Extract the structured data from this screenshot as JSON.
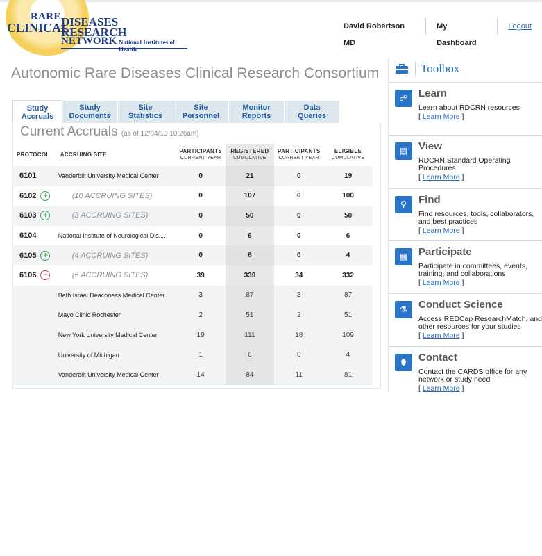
{
  "logo": {
    "line_rare": "RARE",
    "line_clinical": "CLINICAL",
    "line_diseases": "DISEASES",
    "line_research": "RESEARCH",
    "line_network": "NETWORK",
    "line_nih": "National Institutes of Health"
  },
  "topnav": {
    "user": "David Robertson MD",
    "dashboard": "My Dashboard",
    "logout": "Logout"
  },
  "page_title": "Autonomic Rare Diseases Clinical Research Consortium",
  "tabs": [
    {
      "label": "Study\nAccruals",
      "active": true
    },
    {
      "label": "Study\nDocuments"
    },
    {
      "label": "Site\nStatistics"
    },
    {
      "label": "Site\nPersonnel"
    },
    {
      "label": "Monitor\nReports"
    },
    {
      "label": "Data\nQueries"
    }
  ],
  "accruals": {
    "title": "Current Accruals",
    "as_of": "(as of 12/04/13 10:26am)",
    "columns": {
      "protocol": "PROTOCOL",
      "site": "ACCRUING SITE",
      "c1_top": "PARTICIPANTS",
      "c1_sub": "CURRENT YEAR",
      "c2_top": "REGISTERED",
      "c2_sub": "CUMULATIVE",
      "c3_top": "PARTICIPANTS",
      "c3_sub": "CURRENT YEAR",
      "c4_top": "ELIGIBLE",
      "c4_sub": "CUMULATIVE"
    },
    "rows": [
      {
        "protocol": "6101",
        "site": "Vanderbilt University Medical Center",
        "toggle": "",
        "c1": "0",
        "c2": "21",
        "c3": "0",
        "c4": "19"
      },
      {
        "protocol": "6102",
        "site": "(10 ACCRUING SITES)",
        "toggle": "+",
        "c1": "0",
        "c2": "107",
        "c3": "0",
        "c4": "100"
      },
      {
        "protocol": "6103",
        "site": "(3 ACCRUING SITES)",
        "toggle": "+",
        "c1": "0",
        "c2": "50",
        "c3": "0",
        "c4": "50"
      },
      {
        "protocol": "6104",
        "site": "National Institute of Neurological Dis....",
        "toggle": "",
        "c1": "0",
        "c2": "6",
        "c3": "0",
        "c4": "6"
      },
      {
        "protocol": "6105",
        "site": "(4 ACCRUING SITES)",
        "toggle": "+",
        "c1": "0",
        "c2": "6",
        "c3": "0",
        "c4": "4"
      },
      {
        "protocol": "6106",
        "site": "(5 ACCRUING SITES)",
        "toggle": "−",
        "c1": "39",
        "c2": "339",
        "c3": "34",
        "c4": "332"
      },
      {
        "protocol": "",
        "site": "Beth Israel Deaconess Medical Center",
        "toggle": "",
        "c1": "3",
        "c2": "87",
        "c3": "3",
        "c4": "87"
      },
      {
        "protocol": "",
        "site": "Mayo Clinic Rochester",
        "toggle": "",
        "c1": "2",
        "c2": "51",
        "c3": "2",
        "c4": "51"
      },
      {
        "protocol": "",
        "site": "New York University Medical Center",
        "toggle": "",
        "c1": "19",
        "c2": "111",
        "c3": "18",
        "c4": "109"
      },
      {
        "protocol": "",
        "site": "University of Michigan",
        "toggle": "",
        "c1": "1",
        "c2": "6",
        "c3": "0",
        "c4": "4"
      },
      {
        "protocol": "",
        "site": "Vanderbilt University Medical Center",
        "toggle": "",
        "c1": "14",
        "c2": "84",
        "c3": "11",
        "c4": "81"
      }
    ]
  },
  "toolbox": {
    "title": "Toolbox",
    "items": [
      {
        "heading": "Learn",
        "desc": "Learn about RDCRN resources",
        "more": "Learn More",
        "icon": "learn-icon"
      },
      {
        "heading": "View",
        "desc": "RDCRN Standard Operating Procedures",
        "more": "Learn More",
        "icon": "document-icon"
      },
      {
        "heading": "Find",
        "desc": "Find resources, tools, collaborators, and best practices",
        "more": "Learn More",
        "icon": "search-icon"
      },
      {
        "heading": "Participate",
        "desc": "Participate in committees, events, training, and collaborations",
        "more": "Learn More",
        "icon": "calendar-icon"
      },
      {
        "heading": "Conduct Science",
        "desc": "Access REDCap ResearchMatch, and other resources for your studies",
        "more": "Learn More",
        "icon": "science-icon"
      },
      {
        "heading": "Contact",
        "desc": "Contact the CARDS office for any network or study need",
        "more": "Learn More",
        "icon": "mouse-icon"
      }
    ],
    "more_open": "[",
    "more_close": "]"
  }
}
